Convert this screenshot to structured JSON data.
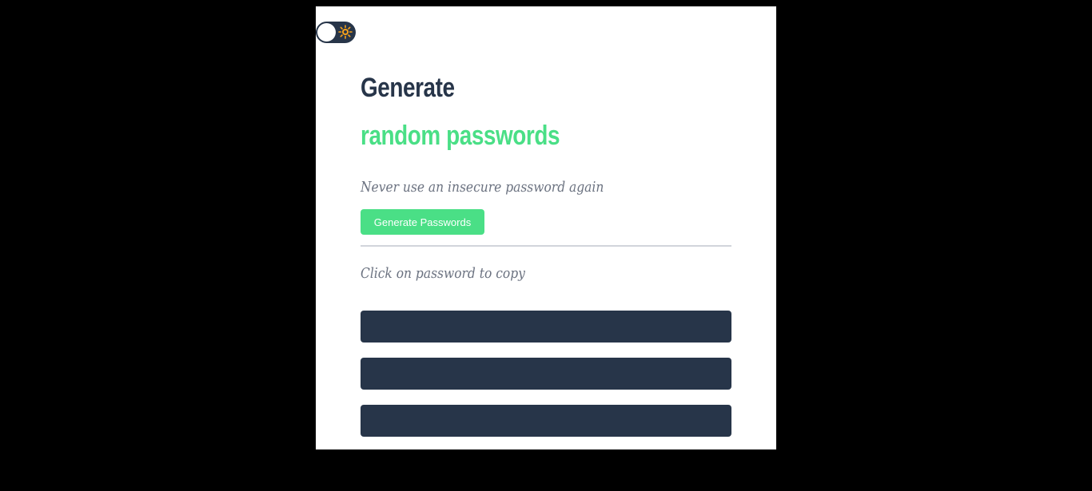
{
  "colors": {
    "background": "#000000",
    "card": "#ffffff",
    "dark": "#273549",
    "accent": "#4ADF86",
    "muted_text": "#6B7280",
    "sun_icon": "#F6A11A"
  },
  "theme_toggle": {
    "state": "light",
    "icon": "sun-icon"
  },
  "hero": {
    "title_line1": "Generate",
    "title_line2": "random passwords",
    "tagline": "Never use an insecure password again"
  },
  "actions": {
    "generate_label": "Generate Passwords"
  },
  "passwords": {
    "hint": "Click on password to copy",
    "items": [
      "",
      "",
      ""
    ]
  }
}
